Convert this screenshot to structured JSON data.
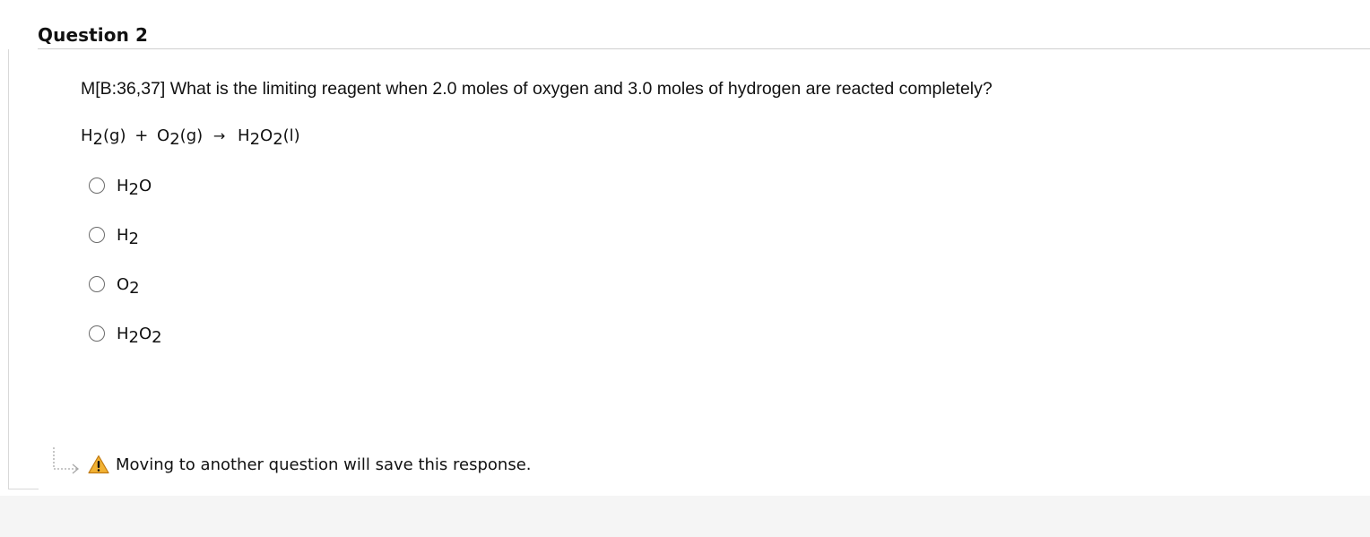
{
  "question": {
    "title": "Question 2",
    "prompt": "M[B:36,37] What is the limiting reagent when 2.0 moles of oxygen and 3.0 moles of hydrogen are reacted completely?",
    "equation": {
      "r1_base": "H",
      "r1_sub": "2",
      "r1_state": "(g)",
      "plus": "+",
      "r2_base": "O",
      "r2_sub": "2",
      "r2_state": "(g)",
      "arrow": "→",
      "p_base1": "H",
      "p_sub1": "2",
      "p_base2": "O",
      "p_sub2": "2",
      "p_state": "(l)"
    },
    "options": [
      {
        "parts": [
          "H",
          "2",
          "O"
        ]
      },
      {
        "parts": [
          "H",
          "2"
        ]
      },
      {
        "parts": [
          "O",
          "2"
        ]
      },
      {
        "parts": [
          "H",
          "2",
          "O",
          "2"
        ]
      }
    ]
  },
  "footer": {
    "notice": "Moving to another question will save this response.",
    "warning_icon": "warning-icon",
    "nav_icon": "dotted-turn-arrow-icon",
    "warning_color": "#f2b233"
  }
}
